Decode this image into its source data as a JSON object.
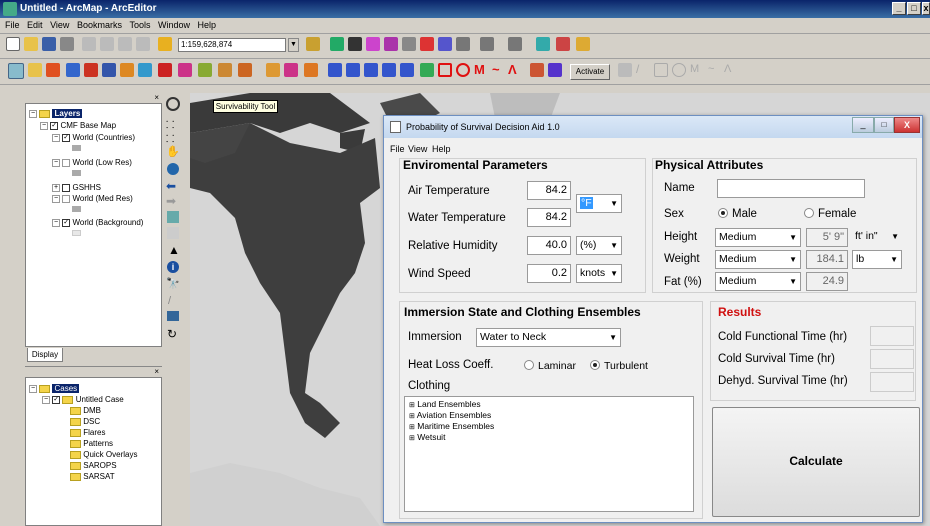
{
  "window": {
    "title": "Untitled - ArcMap - ArcEditor"
  },
  "menu": [
    "File",
    "Edit",
    "View",
    "Bookmarks",
    "Tools",
    "Window",
    "Help"
  ],
  "toolbar": {
    "scale": "1:159,628,874",
    "activate_label": "Activate"
  },
  "survivability_tool_label": "Survivability Tool",
  "toc": {
    "layers_label": "Layers",
    "items": [
      {
        "label": "CMF Base Map"
      },
      {
        "label": "World (Countries)"
      },
      {
        "label": "World (Low Res)"
      },
      {
        "label": "GSHHS"
      },
      {
        "label": "World (Med Res)"
      },
      {
        "label": "World (Background)"
      }
    ],
    "display_tab": "Display"
  },
  "cases": {
    "root": "Cases",
    "case": "Untitled Case",
    "children": [
      "DMB",
      "DSC",
      "Flares",
      "Patterns",
      "Quick Overlays",
      "SAROPS",
      "SARSAT"
    ]
  },
  "dialog": {
    "title": "Probability of Survival Decision Aid 1.0",
    "menu": [
      "File",
      "View",
      "Help"
    ],
    "env": {
      "heading": "Enviromental Parameters",
      "air_label": "Air Temperature",
      "air_value": "84.2",
      "water_label": "Water Temperature",
      "water_value": "84.2",
      "temp_unit": "°F",
      "rh_label": "Relative Humidity",
      "rh_value": "40.0",
      "rh_unit": "(%)",
      "wind_label": "Wind Speed",
      "wind_value": "0.2",
      "wind_unit": "knots"
    },
    "phys": {
      "heading": "Physical Attributes",
      "name_label": "Name",
      "name_value": "",
      "sex_label": "Sex",
      "male": "Male",
      "female": "Female",
      "height_label": "Height",
      "height_select": "Medium",
      "height_value": "5' 9\"",
      "height_unit": "ft' in\"",
      "weight_label": "Weight",
      "weight_select": "Medium",
      "weight_value": "184.1",
      "weight_unit": "lb",
      "fat_label": "Fat (%)",
      "fat_select": "Medium",
      "fat_value": "24.9"
    },
    "immersion": {
      "heading": "Immersion State and Clothing Ensembles",
      "immersion_label": "Immersion",
      "immersion_value": "Water to Neck",
      "heatloss_label": "Heat Loss Coeff.",
      "laminar": "Laminar",
      "turbulent": "Turbulent",
      "clothing_label": "Clothing",
      "clothing_items": [
        "Land Ensembles",
        "Aviation Ensembles",
        "Maritime Ensembles",
        "Wetsuit"
      ]
    },
    "results": {
      "heading": "Results",
      "cold_func": "Cold Functional Time (hr)",
      "cold_surv": "Cold Survival Time (hr)",
      "dehyd": "Dehyd. Survival Time (hr)"
    },
    "calculate": "Calculate"
  }
}
